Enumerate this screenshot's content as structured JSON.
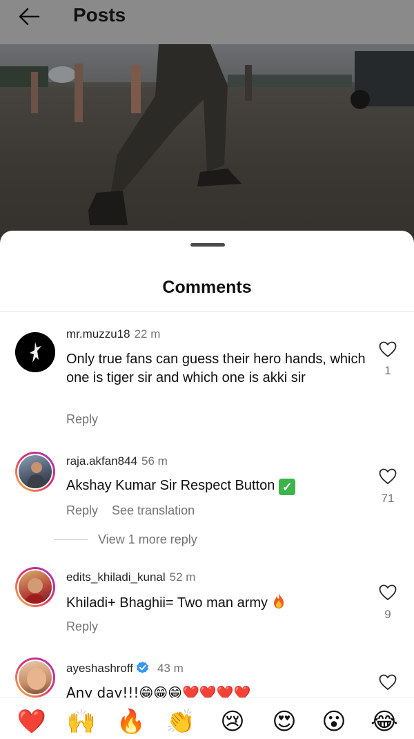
{
  "header": {
    "back_icon": "arrow-left-icon",
    "title": "Posts"
  },
  "sheet": {
    "title": "Comments"
  },
  "comments": [
    {
      "username": "mr.muzzu18",
      "time": "22 m",
      "verified": false,
      "text": "Only true fans can guess their hero hands, which one is tiger sir and which one is akki sir",
      "actions": [
        "Reply"
      ],
      "likes": "1"
    },
    {
      "username": "raja.akfan844",
      "time": "56 m",
      "verified": false,
      "text": "Akshay Kumar Sir Respect Button",
      "text_emoji": "check-mark-icon",
      "actions": [
        "Reply",
        "See translation"
      ],
      "likes": "71",
      "view_more": "View 1 more reply"
    },
    {
      "username": "edits_khiladi_kunal",
      "time": "52 m",
      "verified": false,
      "text": "Khiladi+ Bhaghii= Two man army",
      "text_emoji": "fire-icon",
      "actions": [
        "Reply"
      ],
      "likes": "9"
    },
    {
      "username": "ayeshashroff",
      "time": "43 m",
      "verified": true,
      "text": "Any day!!!😁😁😁❤️❤️❤️❤️",
      "likes": ""
    }
  ],
  "emoji_bar": [
    "❤️",
    "🙌",
    "🔥",
    "👏",
    "😢",
    "😍",
    "😮",
    "😂"
  ],
  "colors": {
    "accent_blue": "#3897f0",
    "secondary_text": "#737373",
    "like_red": "#e0245e"
  }
}
